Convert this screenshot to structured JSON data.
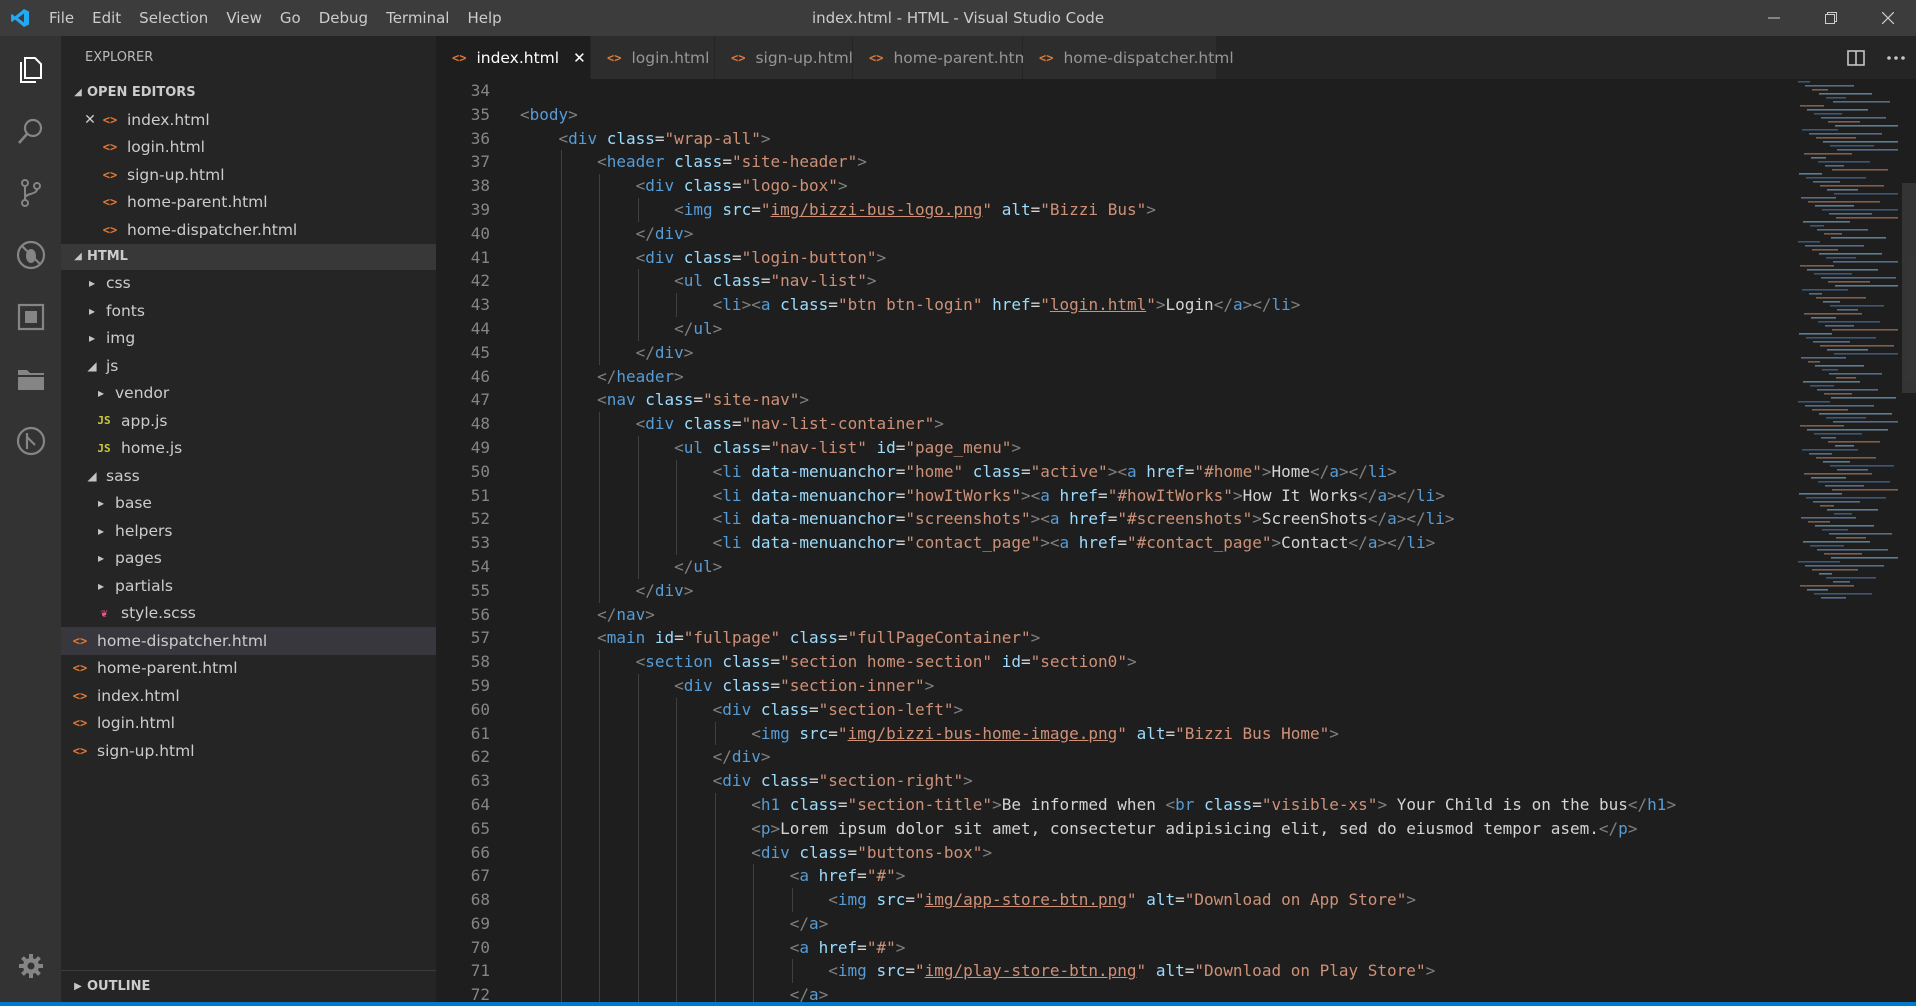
{
  "titlebar": {
    "menu": [
      "File",
      "Edit",
      "Selection",
      "View",
      "Go",
      "Debug",
      "Terminal",
      "Help"
    ],
    "title": "index.html - HTML - Visual Studio Code"
  },
  "sidebar": {
    "title": "EXPLORER",
    "open_editors_label": "OPEN EDITORS",
    "open_editors": [
      "index.html",
      "login.html",
      "sign-up.html",
      "home-parent.html",
      "home-dispatcher.html"
    ],
    "folder_label": "HTML",
    "tree": [
      {
        "label": "css",
        "type": "folder"
      },
      {
        "label": "fonts",
        "type": "folder"
      },
      {
        "label": "img",
        "type": "folder"
      },
      {
        "label": "js",
        "type": "folder-open"
      },
      {
        "label": "vendor",
        "type": "folder"
      },
      {
        "label": "app.js",
        "type": "js"
      },
      {
        "label": "home.js",
        "type": "js"
      },
      {
        "label": "sass",
        "type": "folder-open"
      },
      {
        "label": "base",
        "type": "folder"
      },
      {
        "label": "helpers",
        "type": "folder"
      },
      {
        "label": "pages",
        "type": "folder"
      },
      {
        "label": "partials",
        "type": "folder"
      },
      {
        "label": "style.scss",
        "type": "scss"
      },
      {
        "label": "home-dispatcher.html",
        "type": "html"
      },
      {
        "label": "home-parent.html",
        "type": "html"
      },
      {
        "label": "index.html",
        "type": "html"
      },
      {
        "label": "login.html",
        "type": "html"
      },
      {
        "label": "sign-up.html",
        "type": "html"
      }
    ],
    "outline_label": "OUTLINE"
  },
  "tabs": [
    "index.html",
    "login.html",
    "sign-up.html",
    "home-parent.html",
    "home-dispatcher.html"
  ],
  "editor": {
    "line_numbers": [
      "34",
      "35",
      "36",
      "37",
      "38",
      "39",
      "40",
      "41",
      "42",
      "43",
      "44",
      "45",
      "46",
      "47",
      "48",
      "49",
      "50",
      "51",
      "52",
      "53",
      "54",
      "55",
      "56",
      "57",
      "58",
      "59",
      "60",
      "61",
      "62",
      "63",
      "64",
      "65",
      "66",
      "67",
      "68",
      "69",
      "70",
      "71",
      "72"
    ],
    "code_lines": [
      "",
      "<body>",
      "    <div class=\"wrap-all\">",
      "        <header class=\"site-header\">",
      "            <div class=\"logo-box\">",
      "                <img src=\"img/bizzi-bus-logo.png\" alt=\"Bizzi Bus\">",
      "            </div>",
      "            <div class=\"login-button\">",
      "                <ul class=\"nav-list\">",
      "                    <li><a class=\"btn btn-login\" href=\"login.html\">Login</a></li>",
      "                </ul>",
      "            </div>",
      "        </header>",
      "        <nav class=\"site-nav\">",
      "            <div class=\"nav-list-container\">",
      "                <ul class=\"nav-list\" id=\"page_menu\">",
      "                    <li data-menuanchor=\"home\" class=\"active\"><a href=\"#home\">Home</a></li>",
      "                    <li data-menuanchor=\"howItWorks\"><a href=\"#howItWorks\">How It Works</a></li>",
      "                    <li data-menuanchor=\"screenshots\"><a href=\"#screenshots\">ScreenShots</a></li>",
      "                    <li data-menuanchor=\"contact_page\"><a href=\"#contact_page\">Contact</a></li>",
      "                </ul>",
      "            </div>",
      "        </nav>",
      "        <main id=\"fullpage\" class=\"fullPageContainer\">",
      "            <section class=\"section home-section\" id=\"section0\">",
      "                <div class=\"section-inner\">",
      "                    <div class=\"section-left\">",
      "                        <img src=\"img/bizzi-bus-home-image.png\" alt=\"Bizzi Bus Home\">",
      "                    </div>",
      "                    <div class=\"section-right\">",
      "                        <h1 class=\"section-title\">Be informed when <br class=\"visible-xs\"> Your Child is on the bus</h1>",
      "                        <p>Lorem ipsum dolor sit amet, consectetur adipisicing elit, sed do eiusmod tempor asem.</p>",
      "                        <div class=\"buttons-box\">",
      "                            <a href=\"#\">",
      "                                <img src=\"img/app-store-btn.png\" alt=\"Download on App Store\">",
      "                            </a>",
      "                            <a href=\"#\">",
      "                                <img src=\"img/play-store-btn.png\" alt=\"Download on Play Store\">",
      "                            </a>"
    ]
  },
  "colors": {
    "titlebar": "#3c3c3c",
    "activitybar": "#333333",
    "sidebar": "#252526",
    "editor": "#1e1e1e",
    "accent": "#007acc",
    "tag": "#569cd6",
    "attr": "#9cdcfe",
    "string": "#ce9178"
  },
  "icons": {
    "activity": [
      "files-icon",
      "search-icon",
      "source-control-icon",
      "debug-icon",
      "extensions-icon",
      "folder-icon",
      "git-history-icon"
    ],
    "bottom": "gear-icon"
  }
}
